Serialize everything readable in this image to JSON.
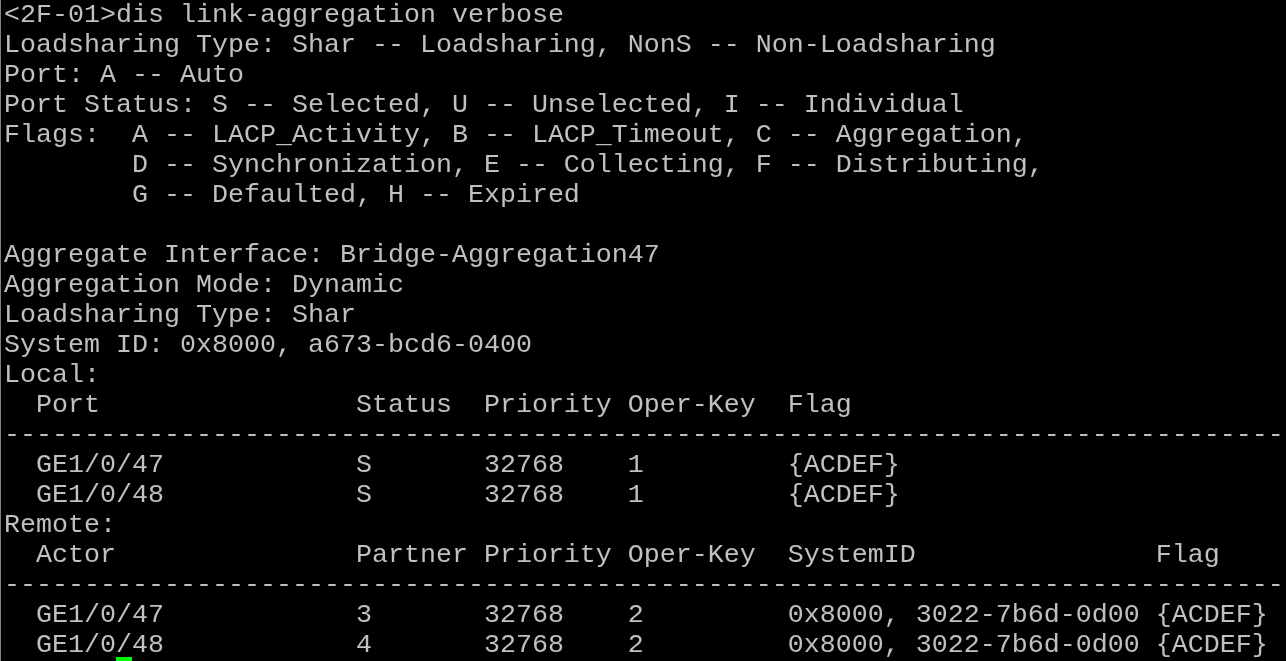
{
  "terminal": {
    "lines": [
      {
        "kind": "text",
        "text": "<2F-01>dis link-aggregation verbose"
      },
      {
        "kind": "text",
        "text": "Loadsharing Type: Shar -- Loadsharing, NonS -- Non-Loadsharing"
      },
      {
        "kind": "text",
        "text": "Port: A -- Auto"
      },
      {
        "kind": "text",
        "text": "Port Status: S -- Selected, U -- Unselected, I -- Individual"
      },
      {
        "kind": "text",
        "text": "Flags:  A -- LACP_Activity, B -- LACP_Timeout, C -- Aggregation,"
      },
      {
        "kind": "text",
        "text": "        D -- Synchronization, E -- Collecting, F -- Distributing,"
      },
      {
        "kind": "text",
        "text": "        G -- Defaulted, H -- Expired"
      },
      {
        "kind": "blank"
      },
      {
        "kind": "text",
        "text": "Aggregate Interface: Bridge-Aggregation47"
      },
      {
        "kind": "text",
        "text": "Aggregation Mode: Dynamic"
      },
      {
        "kind": "text",
        "text": "Loadsharing Type: Shar"
      },
      {
        "kind": "text",
        "text": "System ID: 0x8000, a673-bcd6-0400"
      },
      {
        "kind": "text",
        "text": "Local:"
      },
      {
        "kind": "text",
        "text": "  Port                Status  Priority Oper-Key  Flag"
      },
      {
        "kind": "text",
        "text": "--------------------------------------------------------------------------------"
      },
      {
        "kind": "text",
        "text": "  GE1/0/47            S       32768    1         {ACDEF}"
      },
      {
        "kind": "text",
        "text": "  GE1/0/48            S       32768    1         {ACDEF}"
      },
      {
        "kind": "text",
        "text": "Remote:"
      },
      {
        "kind": "text",
        "text": "  Actor               Partner Priority Oper-Key  SystemID               Flag"
      },
      {
        "kind": "text",
        "text": "--------------------------------------------------------------------------------"
      },
      {
        "kind": "text",
        "text": "  GE1/0/47            3       32768    2         0x8000, 3022-7b6d-0d00 {ACDEF}"
      },
      {
        "kind": "text",
        "text": "  GE1/0/48            4       32768    2         0x8000, 3022-7b6d-0d00 {ACDEF}",
        "cursor": true
      }
    ]
  }
}
